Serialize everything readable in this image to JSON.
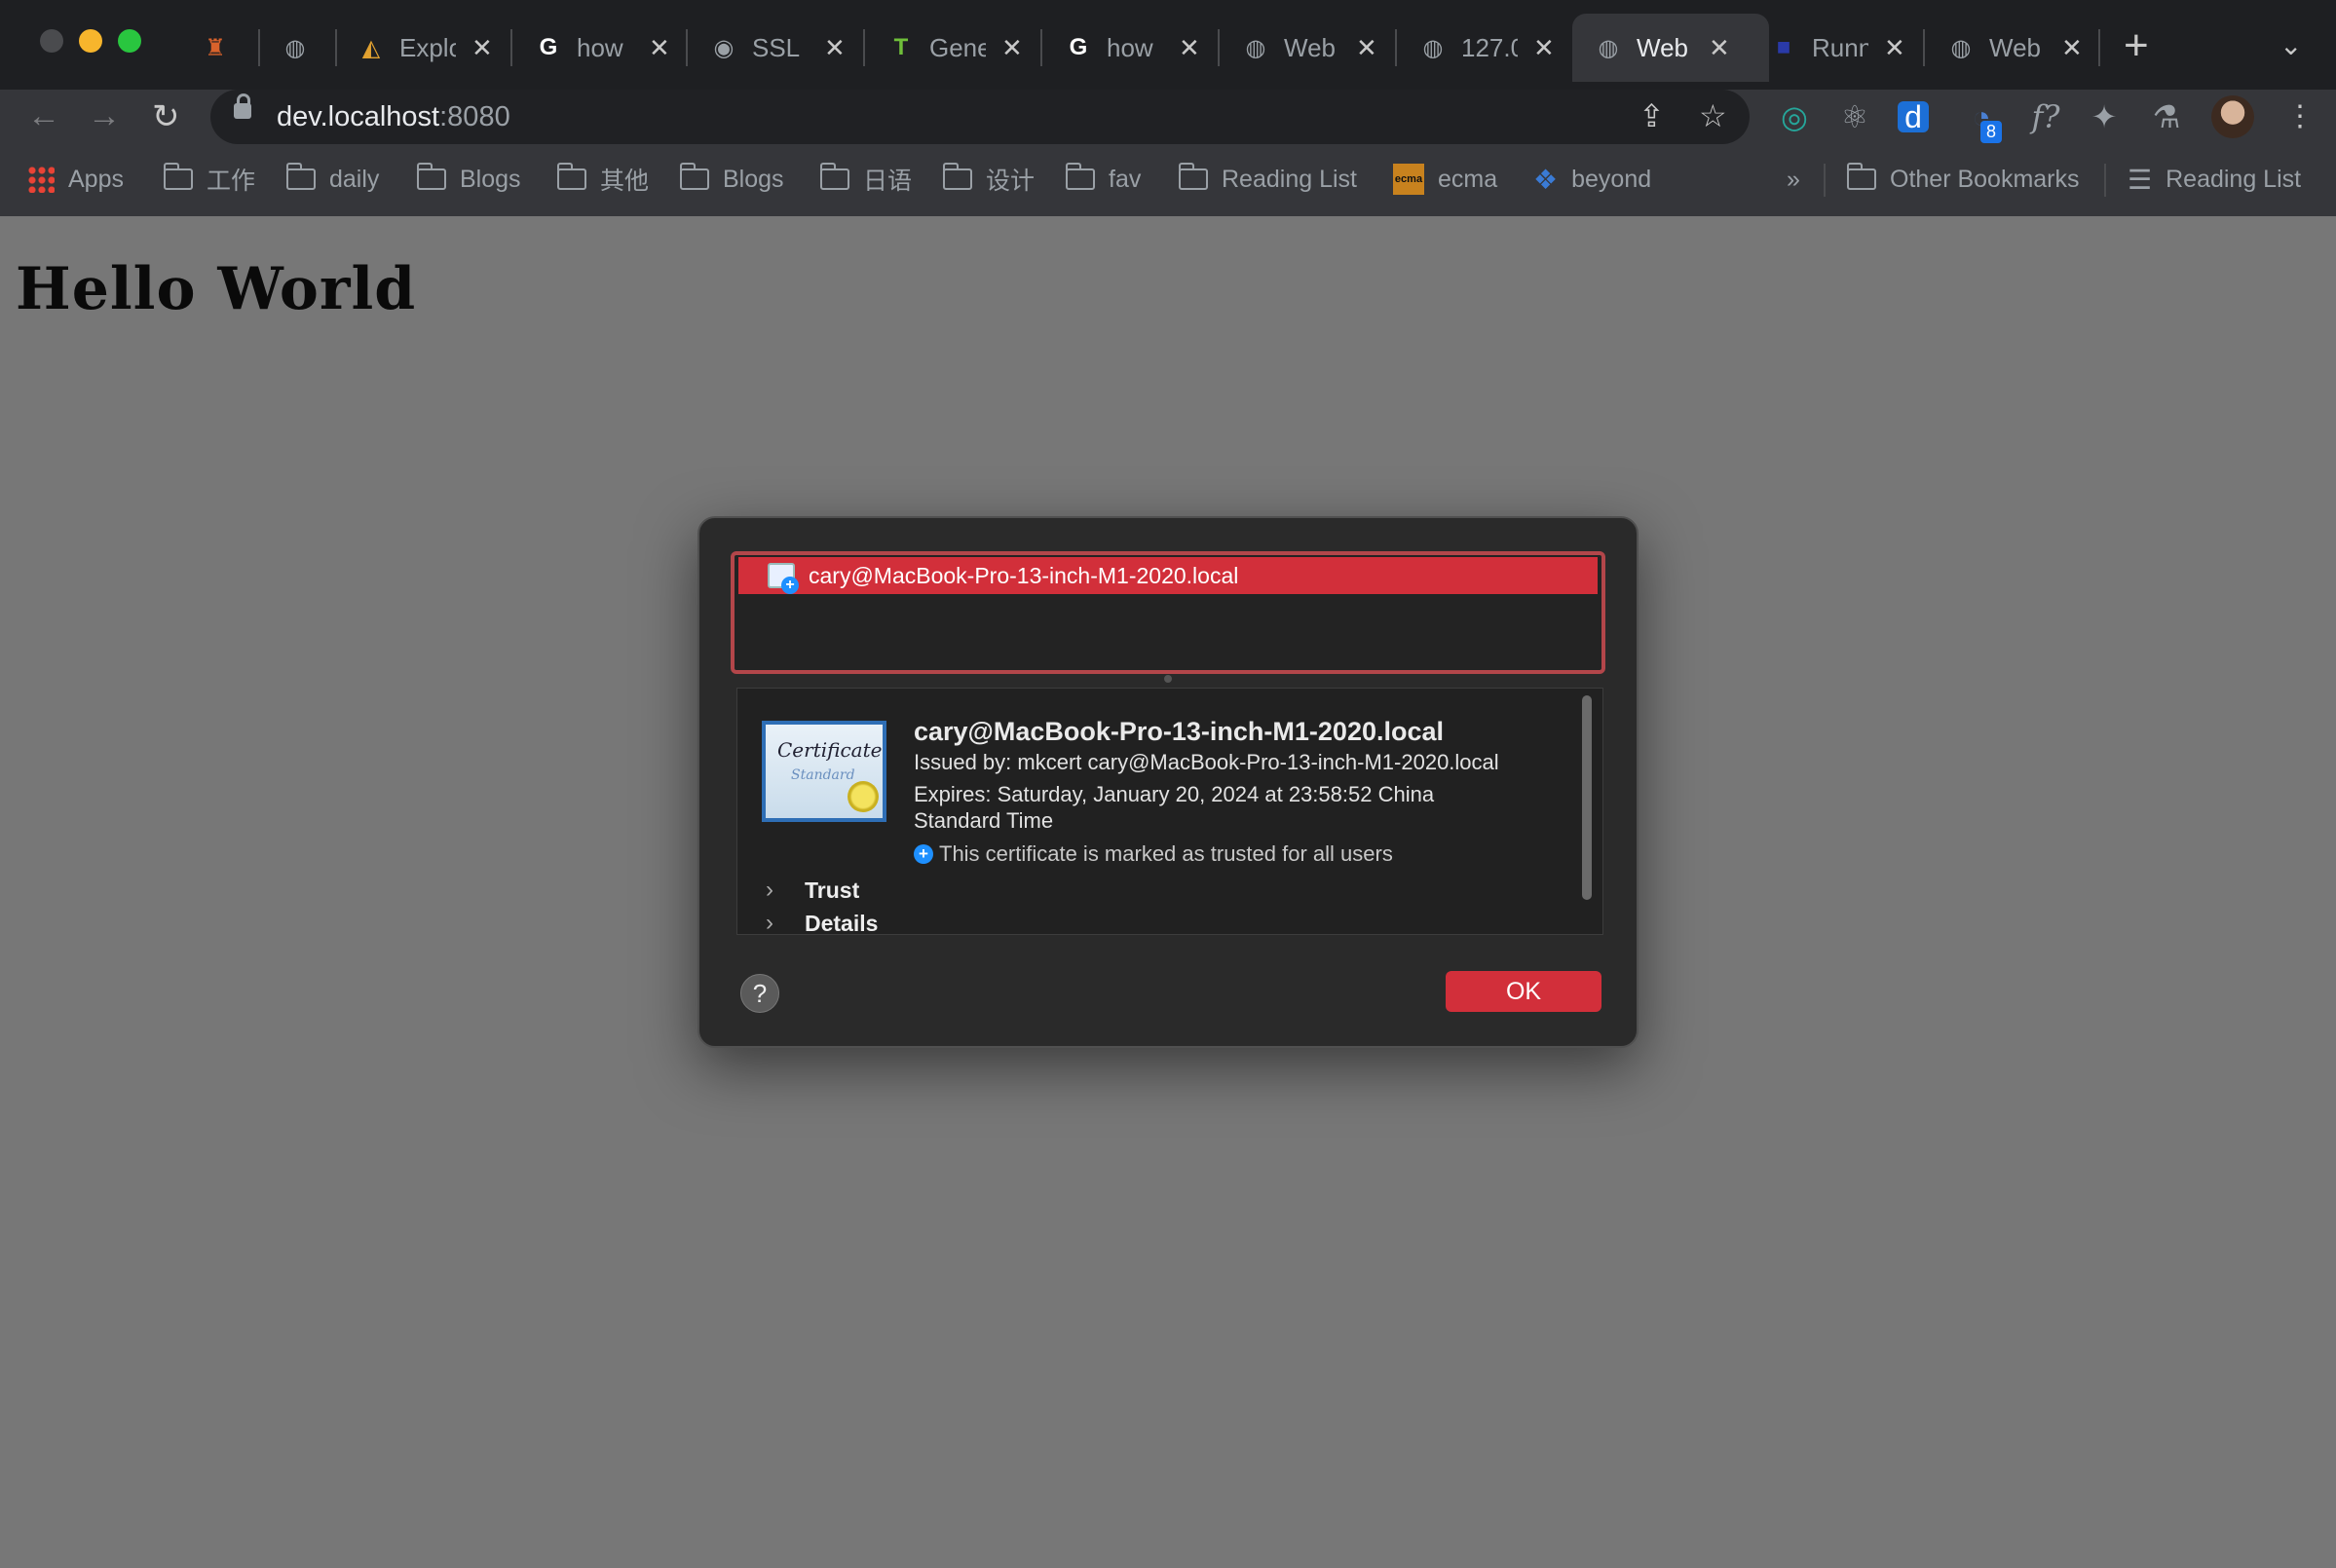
{
  "browser": {
    "tabs": [
      {
        "title": "",
        "icon": "game-icon",
        "active": false
      },
      {
        "title": "",
        "icon": "globe-icon",
        "active": false
      },
      {
        "title": "Explo",
        "icon": "explorer-icon",
        "active": false
      },
      {
        "title": "how",
        "icon": "google-icon",
        "active": false
      },
      {
        "title": "SSL",
        "icon": "github-icon",
        "active": false
      },
      {
        "title": "Gene",
        "icon": "t-logo-icon",
        "active": false
      },
      {
        "title": "how",
        "icon": "google-icon",
        "active": false
      },
      {
        "title": "Web",
        "icon": "globe-icon",
        "active": false
      },
      {
        "title": "127.0",
        "icon": "globe-icon",
        "active": false
      },
      {
        "title": "Web",
        "icon": "globe-icon",
        "active": true
      },
      {
        "title": "Runn",
        "icon": "blue-square-icon",
        "active": false
      },
      {
        "title": "Web",
        "icon": "globe-icon",
        "active": false
      }
    ],
    "close_glyph": "✕",
    "new_tab_glyph": "+",
    "address": {
      "host": "dev.localhost",
      "port": ":8080"
    },
    "extension_badge": "8",
    "bookmarks": [
      {
        "label": "Apps",
        "icon": "apps-grid-icon"
      },
      {
        "label": "工作",
        "icon": "folder-icon"
      },
      {
        "label": "daily",
        "icon": "folder-icon"
      },
      {
        "label": "Blogs",
        "icon": "folder-icon"
      },
      {
        "label": "其他",
        "icon": "folder-icon"
      },
      {
        "label": "Blogs",
        "icon": "folder-icon"
      },
      {
        "label": "日语",
        "icon": "folder-icon"
      },
      {
        "label": "设计",
        "icon": "folder-icon"
      },
      {
        "label": "fav",
        "icon": "folder-icon"
      },
      {
        "label": "Reading List",
        "icon": "folder-icon"
      },
      {
        "label": "ecma",
        "icon": "ecma-icon"
      },
      {
        "label": "beyond",
        "icon": "beyond-icon"
      }
    ],
    "overflow": "»",
    "other_bookmarks": "Other Bookmarks",
    "reading_list": "Reading List"
  },
  "page": {
    "heading": "Hello World"
  },
  "dialog": {
    "list_item": "cary@MacBook-Pro-13-inch-M1-2020.local",
    "cert_image_text_1": "Certificate",
    "cert_image_text_2": "Standard",
    "cert_name": "cary@MacBook-Pro-13-inch-M1-2020.local",
    "issued_by": "Issued by: mkcert cary@MacBook-Pro-13-inch-M1-2020.local",
    "expires_line1": "Expires: Saturday, January 20, 2024 at 23:58:52 China",
    "expires_line2": "Standard Time",
    "trusted_note": "This certificate is marked as trusted for all users",
    "trust_label": "Trust",
    "details_label": "Details",
    "help_label": "?",
    "ok_label": "OK"
  },
  "colors": {
    "accent": "#d22f3a",
    "page_bg": "#777777",
    "dialog_bg": "#2a2a2a"
  }
}
